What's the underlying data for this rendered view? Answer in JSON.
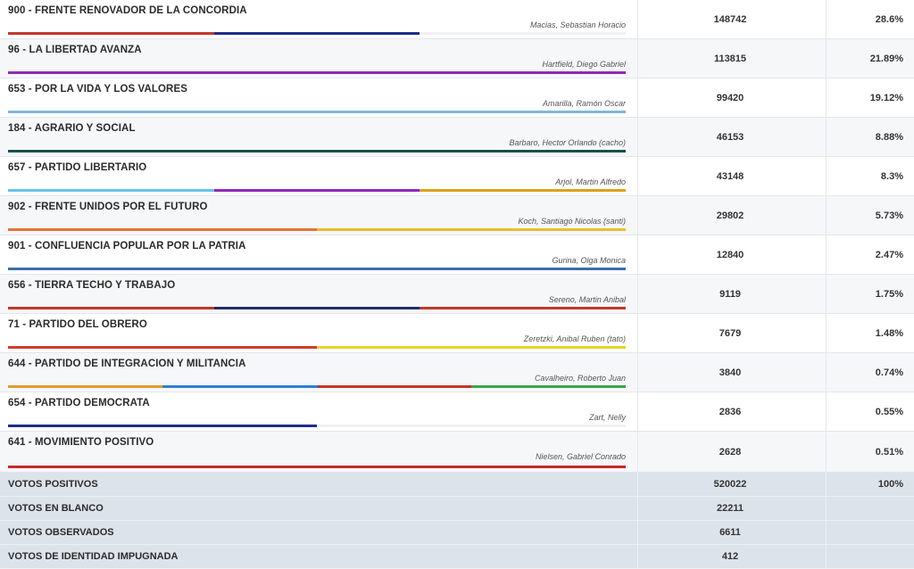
{
  "parties": [
    {
      "name": "900 - FRENTE RENOVADOR DE LA CONCORDIA",
      "candidate": "Macias, Sebastian Horacio",
      "votes": "148742",
      "percent": "28.6%",
      "bar_colors": [
        "#c0392b",
        "#1f2d8a",
        "#f1f1f3"
      ]
    },
    {
      "name": "96 - LA LIBERTAD AVANZA",
      "candidate": "Hartfield, Diego Gabriel",
      "votes": "113815",
      "percent": "21.89%",
      "bar_colors": [
        "#8e2bb6"
      ]
    },
    {
      "name": "653 - POR LA VIDA Y LOS VALORES",
      "candidate": "Amarilla, Ramón Oscar",
      "votes": "99420",
      "percent": "19.12%",
      "bar_colors": [
        "#7fb6d9"
      ]
    },
    {
      "name": "184 - AGRARIO Y SOCIAL",
      "candidate": "Barbaro, Hector Orlando (cacho)",
      "votes": "46153",
      "percent": "8.88%",
      "bar_colors": [
        "#1b4e4e"
      ]
    },
    {
      "name": "657 - PARTIDO LIBERTARIO",
      "candidate": "Arjol, Martin Alfredo",
      "votes": "43148",
      "percent": "8.3%",
      "bar_colors": [
        "#67c3e6",
        "#8e2bb6",
        "#d9a31b"
      ]
    },
    {
      "name": "902 - FRENTE UNIDOS POR EL FUTURO",
      "candidate": "Koch, Santiago Nicolas (santi)",
      "votes": "29802",
      "percent": "5.73%",
      "bar_colors": [
        "#e2733b",
        "#e7bf2e"
      ]
    },
    {
      "name": "901 - CONFLUENCIA POPULAR POR LA PATRIA",
      "candidate": "Gurina, Olga Monica",
      "votes": "12840",
      "percent": "2.47%",
      "bar_colors": [
        "#3b6fa8"
      ]
    },
    {
      "name": "656 - TIERRA TECHO Y TRABAJO",
      "candidate": "Sereno, Martin Anibal",
      "votes": "9119",
      "percent": "1.75%",
      "bar_colors": [
        "#c0392b",
        "#1f2d6b",
        "#c0392b"
      ]
    },
    {
      "name": "71 - PARTIDO DEL OBRERO",
      "candidate": "Zeretzki, Anibal Ruben (tato)",
      "votes": "7679",
      "percent": "1.48%",
      "bar_colors": [
        "#d13b2e",
        "#e3d52a"
      ]
    },
    {
      "name": "644 - PARTIDO DE INTEGRACION Y MILITANCIA",
      "candidate": "Cavalheiro, Roberto Juan",
      "votes": "3840",
      "percent": "0.74%",
      "bar_colors": [
        "#e39a33",
        "#2f7fd6",
        "#c0392b",
        "#3fa34d"
      ]
    },
    {
      "name": "654 - PARTIDO DEMOCRATA",
      "candidate": "Zart, Nelly",
      "votes": "2836",
      "percent": "0.55%",
      "bar_colors": [
        "#1f2d8a",
        "#f1f1f3"
      ]
    },
    {
      "name": "641 - MOVIMIENTO POSITIVO",
      "candidate": "Nielsen, Gabriel Conrado",
      "votes": "2628",
      "percent": "0.51%",
      "bar_colors": [
        "#c62b2b"
      ]
    }
  ],
  "summary": [
    {
      "label": "VOTOS POSITIVOS",
      "votes": "520022",
      "percent": "100%"
    },
    {
      "label": "VOTOS EN BLANCO",
      "votes": "22211",
      "percent": ""
    },
    {
      "label": "VOTOS OBSERVADOS",
      "votes": "6611",
      "percent": ""
    },
    {
      "label": "VOTOS DE IDENTIDAD IMPUGNADA",
      "votes": "412",
      "percent": ""
    }
  ]
}
